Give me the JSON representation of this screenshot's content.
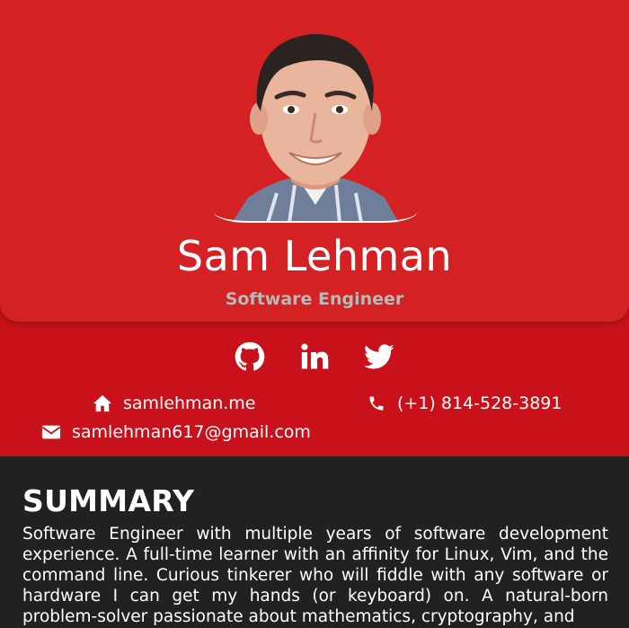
{
  "profile": {
    "name": "Sam Lehman",
    "title": "Software Engineer",
    "photo_alt": "Portrait of Sam Lehman"
  },
  "socials": [
    {
      "name": "GitHub",
      "icon": "github-icon"
    },
    {
      "name": "LinkedIn",
      "icon": "linkedin-icon"
    },
    {
      "name": "Twitter",
      "icon": "twitter-icon"
    }
  ],
  "contact": {
    "website": "samlehman.me",
    "phone": "(+1) 814-528-3891",
    "email": "samlehman617@gmail.com"
  },
  "summary": {
    "heading": "SUMMARY",
    "text": "Software Engineer with multiple years of software development experience. A full-time learner with an affinity for Linux, Vim, and the command line. Curious tinkerer who will fiddle with any software or hardware I can get my hands (or keyboard) on. A natural-born problem-solver passionate about mathematics, cryptography, and"
  },
  "colors": {
    "header_card": "#d42124",
    "contact_band": "#c8111a",
    "body_bg": "#212121",
    "title_text": "#b9b9b9"
  }
}
